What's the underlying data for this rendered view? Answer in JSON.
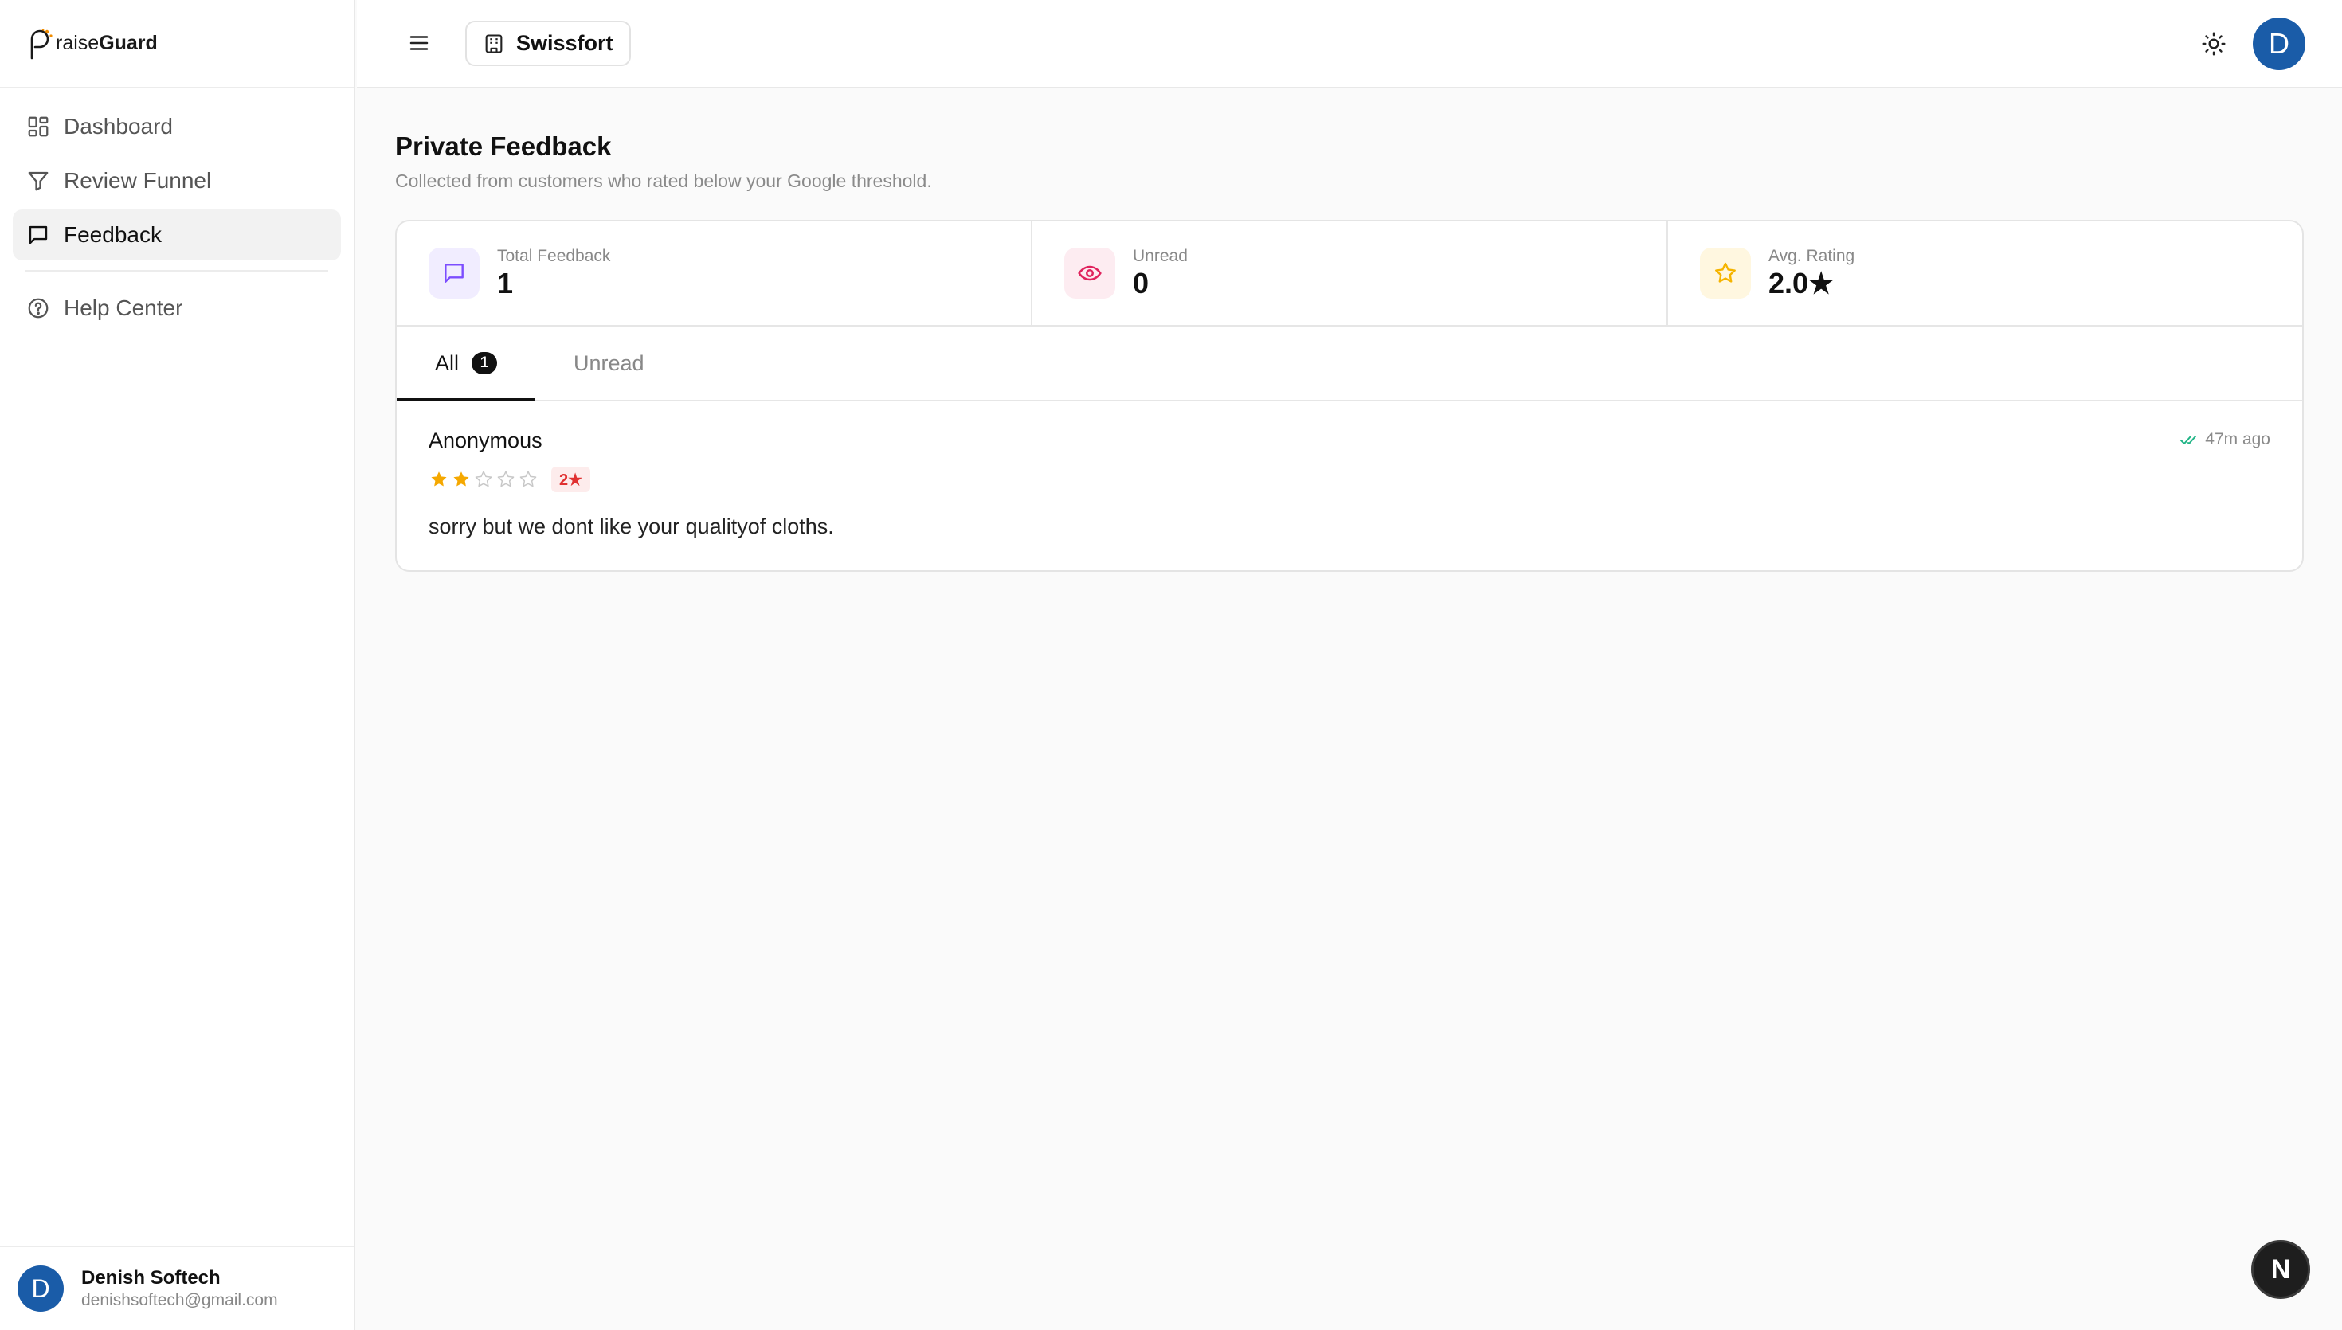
{
  "brand": {
    "prefix": "raise",
    "suffix": "Guard",
    "accent": "#f08c00"
  },
  "sidebar": {
    "items": [
      {
        "label": "Dashboard",
        "icon": "layout-grid-icon"
      },
      {
        "label": "Review Funnel",
        "icon": "filter-icon"
      },
      {
        "label": "Feedback",
        "icon": "message-square-icon",
        "active": true
      }
    ],
    "help": {
      "label": "Help Center",
      "icon": "help-circle-icon"
    },
    "user": {
      "initial": "D",
      "name": "Denish Softech",
      "email": "denishsoftech@gmail.com"
    }
  },
  "header": {
    "business": "Swissfort",
    "avatar_initial": "D",
    "avatar_color": "#1a5ca8"
  },
  "page": {
    "title": "Private Feedback",
    "subtitle": "Collected from customers who rated below your Google threshold."
  },
  "stats": [
    {
      "label": "Total Feedback",
      "value": "1",
      "icon": "message-square-icon",
      "color": "#7c4dff"
    },
    {
      "label": "Unread",
      "value": "0",
      "icon": "eye-icon",
      "color": "#e0245e"
    },
    {
      "label": "Avg. Rating",
      "value": "2.0★",
      "icon": "star-icon",
      "color": "#f5b400"
    }
  ],
  "tabs": [
    {
      "label": "All",
      "count": "1",
      "active": true
    },
    {
      "label": "Unread"
    }
  ],
  "feedback": [
    {
      "name": "Anonymous",
      "rating": 2,
      "max_rating": 5,
      "rating_badge": "2★",
      "text": "sorry but we dont like your qualityof cloths.",
      "time": "47m ago",
      "read": true
    }
  ],
  "next_badge": "N"
}
